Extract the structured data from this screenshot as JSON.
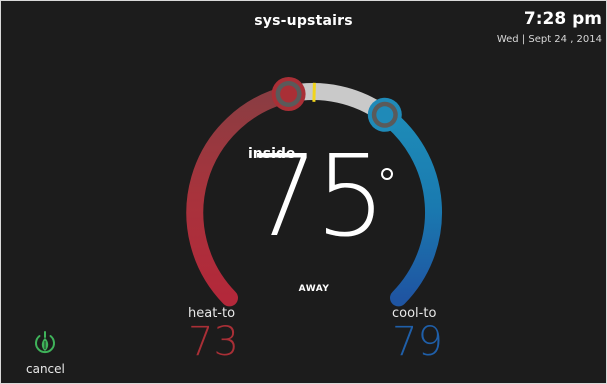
{
  "header": {
    "title": "sys-upstairs",
    "time": "7:28 pm",
    "date": "Wed | Sept 24 , 2014"
  },
  "dial": {
    "inside_label": "inside",
    "inside_temp": "75",
    "mode": "AWAY"
  },
  "heat": {
    "label": "heat-to",
    "value": "73"
  },
  "cool": {
    "label": "cool-to",
    "value": "79"
  },
  "cancel": {
    "label": "cancel",
    "icon": "leaf-icon"
  },
  "colors": {
    "background": "#1c1c1c",
    "heat": "#a92f36",
    "cool": "#1f5fa9",
    "neutral_arc": "#c9c9c9",
    "current_marker": "#f1d51c",
    "leaf": "#3fb35a"
  }
}
